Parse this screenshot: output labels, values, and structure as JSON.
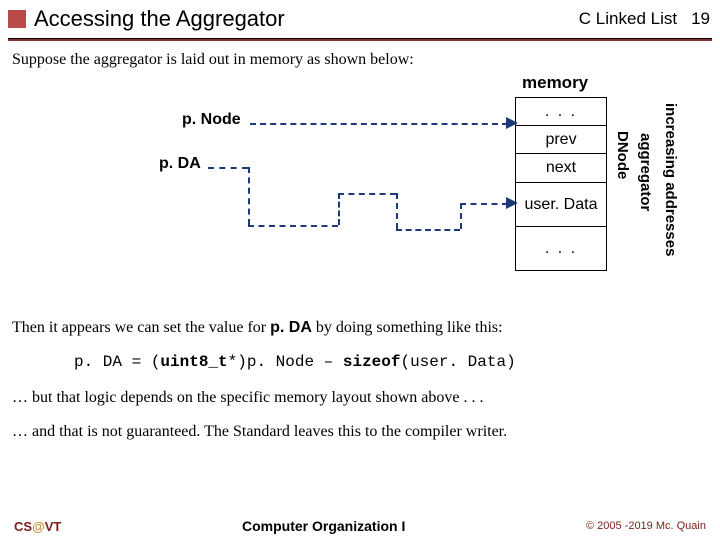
{
  "header": {
    "title": "Accessing the Aggregator",
    "chapter": "C Linked List",
    "pagenum": "19"
  },
  "body": {
    "suppose": "Suppose the aggregator is laid out in memory as shown below:",
    "memory_label": "memory",
    "pnode_label": "p. Node",
    "pda_label": "p. DA",
    "cells": {
      "dots1": ". . .",
      "prev": "prev",
      "next": "next",
      "userdata": "user. Data",
      "dots2": ". . ."
    },
    "vlabels": {
      "dnode": "DNode",
      "aggregator": "aggregator",
      "increasing": "increasing addresses"
    },
    "then_line_pre": "Then it appears we can set the value for ",
    "then_line_bold": "p. DA",
    "then_line_post": " by doing something like this:",
    "code_line": "p. DA = (uint8_t*)p. Node – sizeof(user. Data)",
    "code_parts": {
      "lhs": "p. DA = (",
      "kw1": "uint8_t",
      "mid": "*)p. Node – ",
      "kw2": "sizeof",
      "tail": "(user. Data)"
    },
    "but_line": "… but that logic depends on the specific memory layout shown above . . .",
    "and_line": "… and that is not guaranteed.  The Standard leaves this to the compiler writer."
  },
  "footer": {
    "left_cs": "CS",
    "left_at": "@",
    "left_vt": "VT",
    "mid": "Computer Organization I",
    "right": "© 2005 -2019 Mc. Quain"
  }
}
